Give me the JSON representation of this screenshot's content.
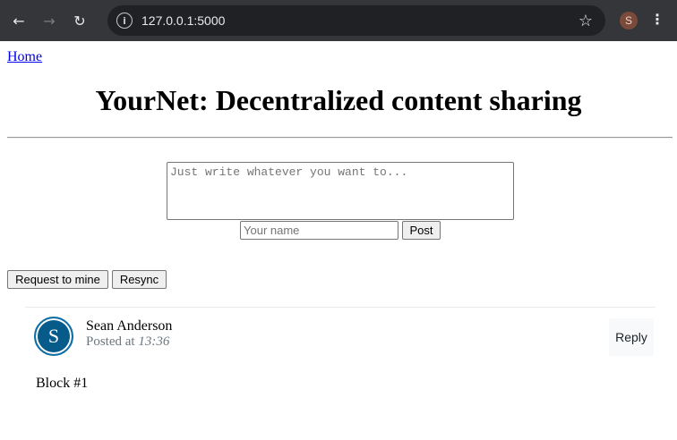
{
  "browser": {
    "url": "127.0.0.1:5000",
    "profile_initial": "S",
    "icons": [
      "back-arrow-icon",
      "forward-arrow-icon",
      "reload-icon",
      "site-info-icon",
      "bookmark-star-icon",
      "kebab-menu-icon"
    ]
  },
  "nav": {
    "home_label": "Home"
  },
  "header": {
    "title": "YourNet: Decentralized content sharing"
  },
  "compose": {
    "content_placeholder": "Just write whatever you want to...",
    "name_placeholder": "Your name",
    "post_label": "Post"
  },
  "actions": {
    "mine_label": "Request to mine",
    "resync_label": "Resync"
  },
  "posts": [
    {
      "avatar_initial": "S",
      "author": "Sean Anderson",
      "posted_prefix": "Posted at",
      "time": "13:36",
      "reply_label": "Reply",
      "content": "Block #1"
    }
  ],
  "colors": {
    "avatar_bg": "#075b8a",
    "link": "#0000ee",
    "chrome_bg": "#35363a"
  }
}
